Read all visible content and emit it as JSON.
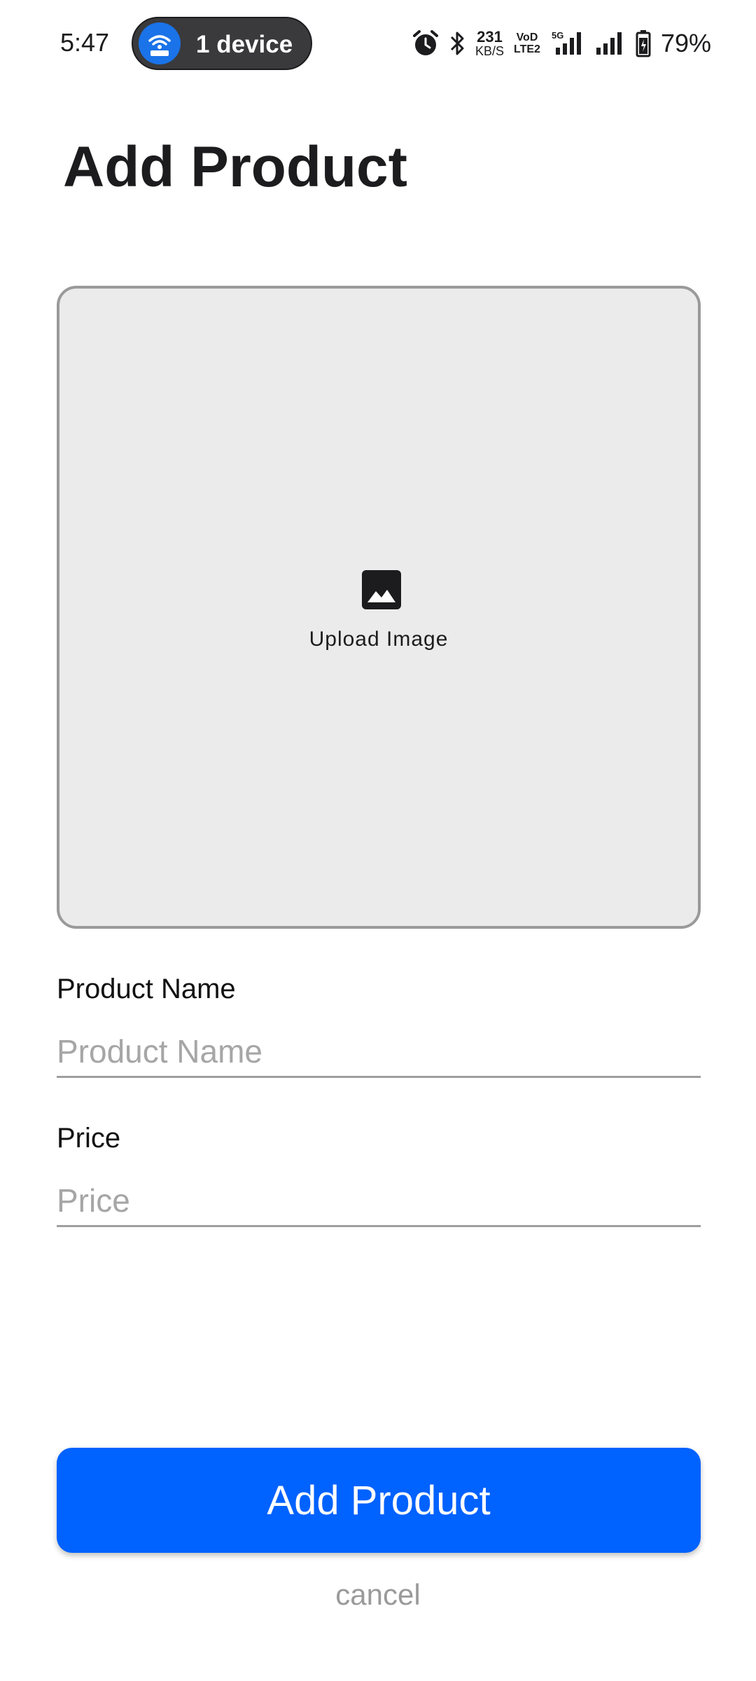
{
  "status_bar": {
    "time": "5:47",
    "device_pill_label": "1 device",
    "net_speed_value": "231",
    "net_speed_unit": "KB/S",
    "volte_top": "VoD",
    "volte_bottom": "LTE2",
    "network_type": "5G",
    "battery_percent": "79%",
    "icons": [
      "router-wifi-icon",
      "alarm-icon",
      "bluetooth-icon",
      "signal-5g-icon",
      "signal-icon",
      "battery-icon"
    ]
  },
  "header": {
    "title": "Add Product"
  },
  "image_upload": {
    "label": "Upload Image",
    "icon": "image-icon"
  },
  "form": {
    "product_name": {
      "label": "Product Name",
      "placeholder": "Product Name",
      "value": ""
    },
    "price": {
      "label": "Price",
      "placeholder": "Price",
      "value": ""
    }
  },
  "actions": {
    "submit_label": "Add Product",
    "cancel_label": "cancel"
  },
  "colors": {
    "primary": "#0062ff",
    "pill_icon_bg": "#1a73e8",
    "upload_bg": "#ebebeb",
    "placeholder": "#a6a6a6"
  }
}
